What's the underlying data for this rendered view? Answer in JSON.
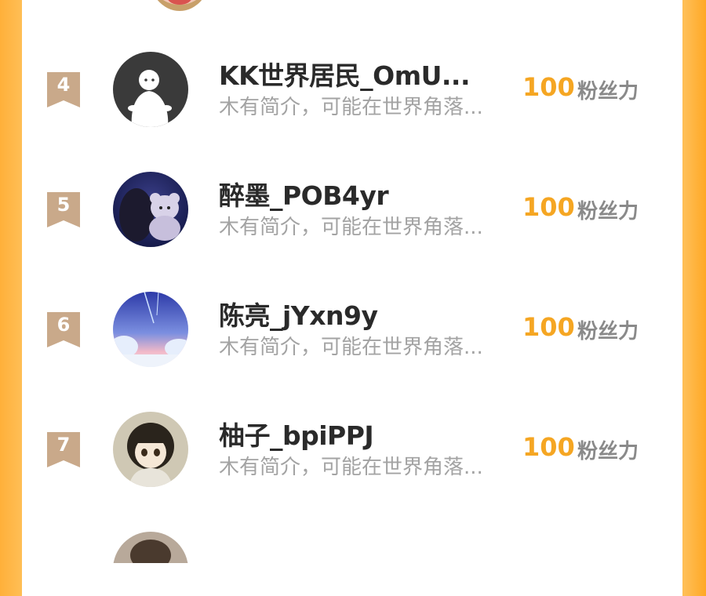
{
  "rows": [
    {
      "rank": "4",
      "name": "KK世界居民_OmU...",
      "bio": "木有简介，可能在世界角落...",
      "score": "100",
      "unit": "粉丝力",
      "avatar_icon": "ghost-avatar-icon"
    },
    {
      "rank": "5",
      "name": "醉墨_POB4yr",
      "bio": "木有简介，可能在世界角落...",
      "score": "100",
      "unit": "粉丝力",
      "avatar_icon": "anime-girl-avatar-icon"
    },
    {
      "rank": "6",
      "name": "陈亮_jYxn9y",
      "bio": "木有简介，可能在世界角落...",
      "score": "100",
      "unit": "粉丝力",
      "avatar_icon": "sky-avatar-icon"
    },
    {
      "rank": "7",
      "name": "柚子_bpiPPJ",
      "bio": "木有简介，可能在世界角落...",
      "score": "100",
      "unit": "粉丝力",
      "avatar_icon": "cartoon-girl-avatar-icon"
    }
  ],
  "colors": {
    "background": "#ffc25f",
    "score": "#f5a623",
    "badge": "#c9a98a",
    "name": "#2a2a2a",
    "bio": "#a3a3a3"
  }
}
